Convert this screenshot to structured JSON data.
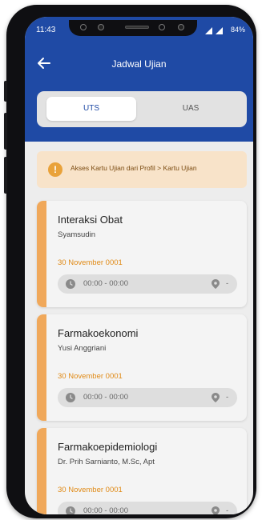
{
  "status": {
    "time": "11:43",
    "battery": "84%"
  },
  "header": {
    "title": "Jadwal Ujian"
  },
  "tabs": [
    {
      "label": "UTS"
    },
    {
      "label": "UAS"
    }
  ],
  "notice": {
    "text": "Akses Kartu Ujian dari Profil > Kartu Ujian"
  },
  "exams": [
    {
      "title": "Interaksi Obat",
      "lecturer": "Syamsudin",
      "date": "30 November 0001",
      "time": "00:00 - 00:00",
      "location": "-"
    },
    {
      "title": "Farmakoekonomi",
      "lecturer": "Yusi Anggriani",
      "date": "30 November 0001",
      "time": "00:00 - 00:00",
      "location": "-"
    },
    {
      "title": "Farmakoepidemiologi",
      "lecturer": "Dr. Prih Sarnianto, M.Sc, Apt",
      "date": "30 November 0001",
      "time": "00:00 - 00:00",
      "location": "-"
    }
  ],
  "colors": {
    "header": "#1f4aa5",
    "accent": "#f0a85a",
    "date": "#e08a16",
    "notice_bg": "#f8e3c9"
  },
  "icons": {
    "back": "arrow-left-icon",
    "info": "info-icon",
    "clock": "clock-icon",
    "location": "map-pin-icon"
  }
}
